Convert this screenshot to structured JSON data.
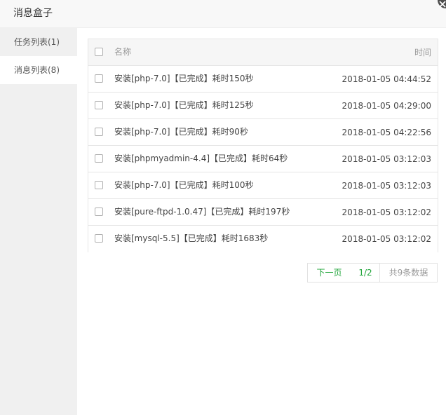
{
  "window": {
    "title": "消息盒子",
    "close_icon": "close-icon"
  },
  "sidebar": {
    "items": [
      {
        "label": "任务列表(1)",
        "active": false
      },
      {
        "label": "消息列表(8)",
        "active": true
      }
    ]
  },
  "table": {
    "headers": {
      "name": "名称",
      "time": "时间"
    },
    "rows": [
      {
        "name": "安装[php-7.0]【已完成】耗时150秒",
        "time": "2018-01-05 04:44:52"
      },
      {
        "name": "安装[php-7.0]【已完成】耗时125秒",
        "time": "2018-01-05 04:29:00"
      },
      {
        "name": "安装[php-7.0]【已完成】耗时90秒",
        "time": "2018-01-05 04:22:56"
      },
      {
        "name": "安装[phpmyadmin-4.4]【已完成】耗时64秒",
        "time": "2018-01-05 03:12:03"
      },
      {
        "name": "安装[php-7.0]【已完成】耗时100秒",
        "time": "2018-01-05 03:12:03"
      },
      {
        "name": "安装[pure-ftpd-1.0.47]【已完成】耗时197秒",
        "time": "2018-01-05 03:12:02"
      },
      {
        "name": "安装[mysql-5.5]【已完成】耗时1683秒",
        "time": "2018-01-05 03:12:02"
      }
    ]
  },
  "pager": {
    "next_label": "下一页",
    "page_label": "1/2",
    "total_label": "共9条数据"
  },
  "colors": {
    "accent": "#20a53a",
    "sidebar_bg": "#f0f0f0",
    "header_bg": "#f6f6f6"
  }
}
